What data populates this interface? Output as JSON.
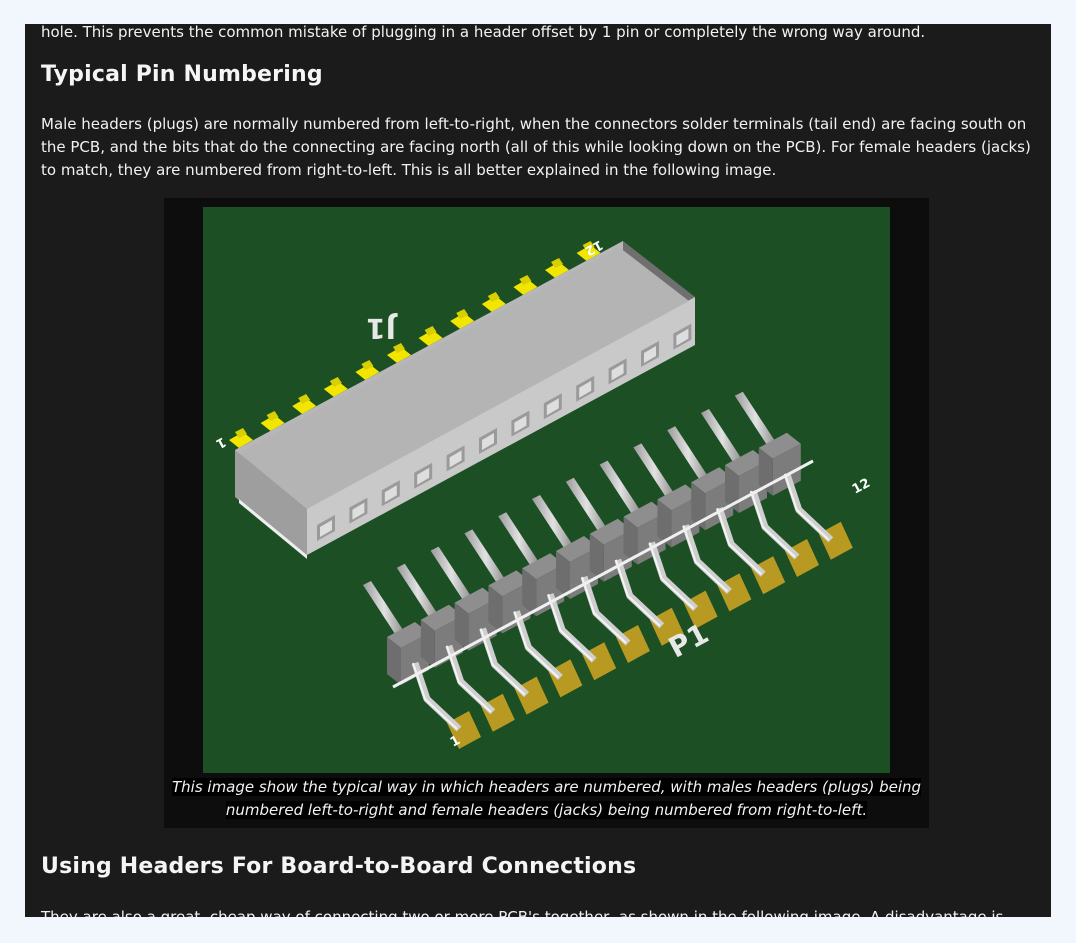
{
  "article": {
    "intro_text": "hole. This prevents the common mistake of plugging in a header offset by 1 pin or completely the wrong way around.",
    "section1_heading": "Typical Pin Numbering",
    "section1_paragraph": "Male headers (plugs) are normally numbered from left-to-right, when the connectors solder terminals (tail end) are facing south on the PCB, and the bits that do the connecting are facing north (all of this while looking down on the PCB). For female headers (jacks) to match, they are numbered from right-to-left. This is all better explained in the following image.",
    "figure": {
      "caption_line1": "This image show the typical way in which headers are numbered, with males headers (plugs) being",
      "caption_line2": "numbered left-to-right and female headers (jacks) being numbered from right-to-left.",
      "female_label": "J1",
      "male_label": "P1",
      "female_pin_first": "1",
      "female_pin_last": "12",
      "male_pin_first": "1",
      "male_pin_last": "12"
    },
    "section2_heading": "Using Headers For Board-to-Board Connections",
    "section2_paragraph": "They are also a great, cheap way of connecting two or more PCB's together, as shown in the following image. A disadvantage is"
  },
  "colors": {
    "page_background": "#f2f6fd",
    "article_background": "#1b1b1b",
    "pcb_green": "#1c4f24",
    "pad_yellow": "#f2e600",
    "pad_gold": "#b89a23"
  }
}
